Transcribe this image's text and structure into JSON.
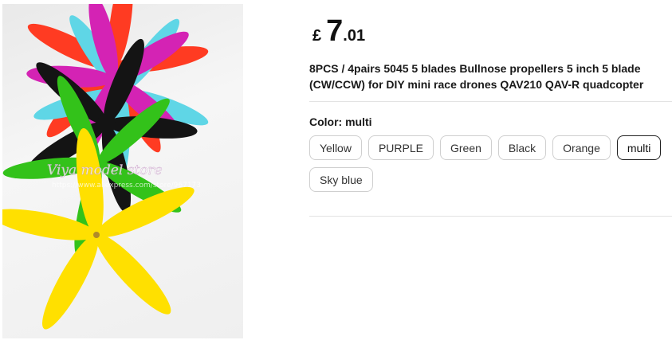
{
  "product": {
    "image": {
      "watermark_line1": "Viya model store",
      "watermark_line2": "https://www.aliexpress.com/store/967173",
      "blade_colors": {
        "red": "#ff3b22",
        "magenta": "#d423b4",
        "skyblue": "#5fd6e6",
        "black": "#141414",
        "green": "#33c21a",
        "yellow": "#ffe000"
      }
    },
    "price": {
      "currency": "£",
      "integer": "7",
      "decimal": ".01"
    },
    "title": "8PCS / 4pairs 5045 5 blades Bullnose propellers 5 inch 5 blade (CW/CCW) for DIY mini race drones QAV210 QAV-R quadcopter",
    "color_selector": {
      "label": "Color:",
      "selected": "multi",
      "options": [
        "Yellow",
        "PURPLE",
        "Green",
        "Black",
        "Orange",
        "multi",
        "Sky blue"
      ]
    }
  }
}
